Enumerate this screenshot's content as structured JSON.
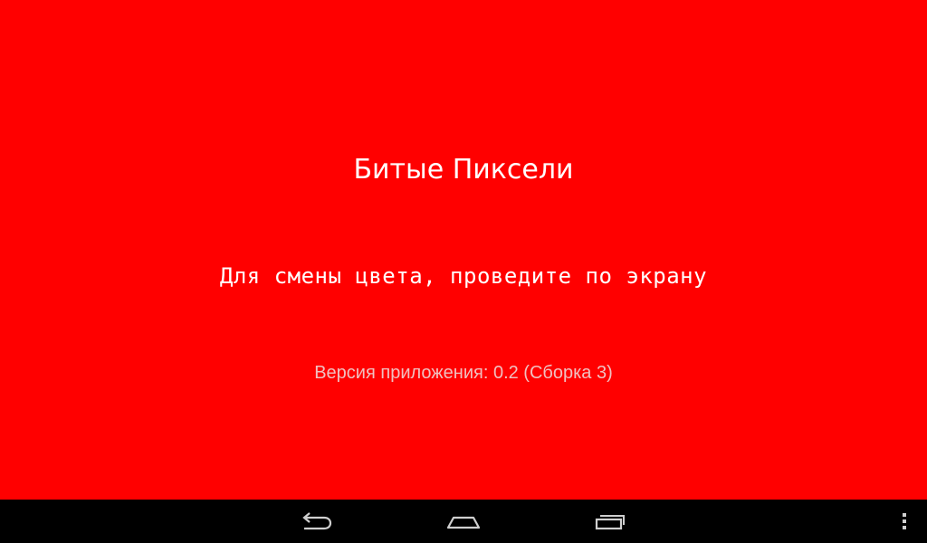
{
  "screen": {
    "background_color": "#ff0000",
    "title": "Битые Пиксели",
    "hint": "Для смены цвета, проведите по экрану",
    "version": "Версия приложения: 0.2 (Сборка 3)"
  },
  "navbar": {
    "background_color": "#000000",
    "icon_color": "#cfcfcf",
    "buttons": [
      {
        "icon": "back-icon"
      },
      {
        "icon": "home-icon"
      },
      {
        "icon": "recents-icon"
      },
      {
        "icon": "overflow-menu-icon"
      }
    ]
  }
}
